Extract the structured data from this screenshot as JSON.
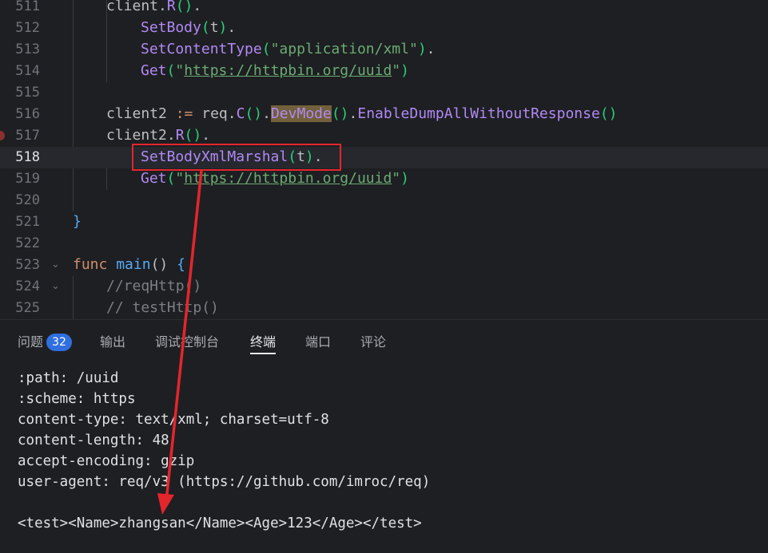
{
  "editor": {
    "lines": [
      {
        "num": "511"
      },
      {
        "num": "512"
      },
      {
        "num": "513"
      },
      {
        "num": "514"
      },
      {
        "num": "515"
      },
      {
        "num": "516"
      },
      {
        "num": "517"
      },
      {
        "num": "518"
      },
      {
        "num": "519"
      },
      {
        "num": "520"
      },
      {
        "num": "521"
      },
      {
        "num": "522"
      },
      {
        "num": "523"
      },
      {
        "num": "524"
      },
      {
        "num": "525"
      }
    ],
    "tokens": {
      "client": "client",
      "dot": ".",
      "R": "R",
      "paren_pair": "()",
      "open": "(",
      "close": ")",
      "SetBody": "SetBody",
      "t": "t",
      "SetContentType": "SetContentType",
      "q": "\"",
      "appxml": "application/xml",
      "Get": "Get",
      "url": "https://httpbin.org/uuid",
      "client2": "client2",
      "assign": ":=",
      "req": "req",
      "C": "C",
      "DevMode": "DevMode",
      "EnableDump": "EnableDumpAllWithoutResponse",
      "SetBodyXml": "SetBodyXmlMarshal",
      "rbrace": "}",
      "func": "func",
      "main": "main",
      "lbrace": "{",
      "cmt1": "//reqHttp()",
      "cmt2": "// testHttp()"
    }
  },
  "panel": {
    "tabs": [
      {
        "label": "问题",
        "badge": "32"
      },
      {
        "label": "输出"
      },
      {
        "label": "调试控制台"
      },
      {
        "label": "终端",
        "active": true
      },
      {
        "label": "端口"
      },
      {
        "label": "评论"
      }
    ],
    "terminal_lines": [
      ":path: /uuid",
      ":scheme: https",
      "content-type: text/xml; charset=utf-8",
      "content-length: 48",
      "accept-encoding: gzip",
      "user-agent: req/v3 (https://github.com/imroc/req)",
      "",
      "<test><Name>zhangsan</Name><Age>123</Age></test>"
    ]
  },
  "annotation": {
    "color": "#e3262c"
  }
}
